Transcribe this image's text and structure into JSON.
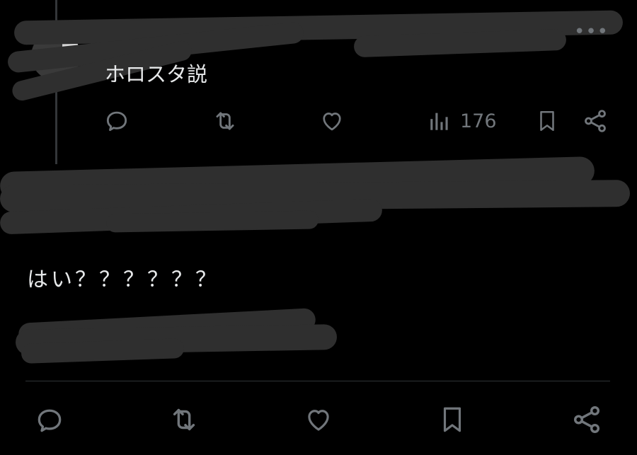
{
  "reply_tweet": {
    "text": "ホロスタ説",
    "more_label": "•••",
    "views": "176"
  },
  "main_tweet": {
    "text": "はい？？？？？？"
  },
  "colors": {
    "background": "#000000",
    "text": "#e7e9ea",
    "icon": "#71767b",
    "redaction": "#2f2f2f"
  },
  "icons": {
    "reply": "speech-bubble-icon",
    "retweet": "retweet-arrows-icon",
    "like": "heart-icon",
    "views": "bar-chart-icon",
    "bookmark": "bookmark-icon",
    "share": "share-icon"
  }
}
